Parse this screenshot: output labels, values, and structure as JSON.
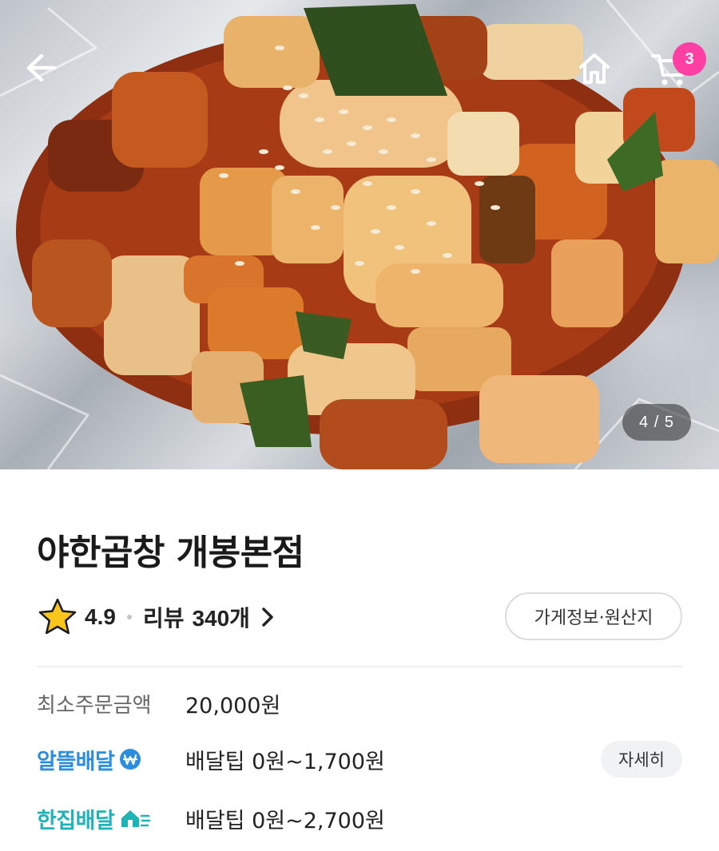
{
  "header": {
    "back_icon": "arrow-left-icon",
    "home_icon": "home-icon",
    "cart_icon": "cart-icon",
    "cart_badge": "3"
  },
  "photo": {
    "counter": "4 / 5"
  },
  "store": {
    "name": "야한곱창 개봉본점",
    "rating": "4.9",
    "review_label": "리뷰",
    "review_count": "340개",
    "info_button": "가게정보·원산지"
  },
  "min_order": {
    "label": "최소주문금액",
    "value": "20,000원"
  },
  "delivery": [
    {
      "brand": "알뜰배달",
      "brand_color": "#2b8de0",
      "tip": "배달팁 0원~1,700원",
      "detail_button": "자세히"
    },
    {
      "brand": "한집배달",
      "brand_color": "#1fb3b8",
      "tip": "배달팁 0원~2,700원"
    }
  ],
  "colors": {
    "badge": "#ff3fa4",
    "star": "#f7c51b"
  }
}
